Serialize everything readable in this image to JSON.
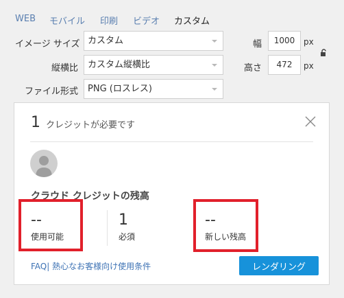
{
  "tabs": [
    {
      "label": "WEB"
    },
    {
      "label": "モバイル"
    },
    {
      "label": "印刷"
    },
    {
      "label": "ビデオ"
    },
    {
      "label": "カスタム"
    }
  ],
  "form": {
    "image_size_label": "イメージ サイズ",
    "image_size_value": "カスタム",
    "aspect_label": "縦横比",
    "aspect_value": "カスタム縦横比",
    "format_label": "ファイル形式",
    "format_value": "PNG (ロスレス)",
    "width_label": "幅",
    "width_value": "1000",
    "height_label": "高さ",
    "height_value": "472",
    "unit": "px"
  },
  "panel": {
    "credits_required": "1",
    "credits_required_text": "クレジットが必要です",
    "title": "クラウド クレジットの残高",
    "stats": [
      {
        "value": "--",
        "label": "使用可能"
      },
      {
        "value": "1",
        "label": "必須"
      },
      {
        "value": "--",
        "label": "新しい残高"
      }
    ],
    "link_text": "FAQ| 熱心なお客様向け使用条件",
    "render_button": "レンダリング"
  },
  "colors": {
    "accent": "#1792da",
    "highlight": "#e1202b",
    "tab_link": "#5a7fb0"
  }
}
